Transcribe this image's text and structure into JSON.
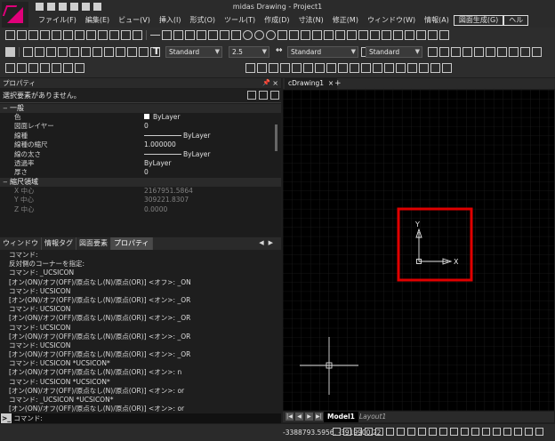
{
  "app": {
    "title": "midas Drawing - Project1"
  },
  "menu": [
    {
      "label": "ファイル(F)"
    },
    {
      "label": "編集(E)"
    },
    {
      "label": "ビュー(V)"
    },
    {
      "label": "挿入(I)"
    },
    {
      "label": "形式(O)"
    },
    {
      "label": "ツール(T)"
    },
    {
      "label": "作成(D)"
    },
    {
      "label": "寸法(N)"
    },
    {
      "label": "修正(M)"
    },
    {
      "label": "ウィンドウ(W)"
    },
    {
      "label": "情報(A)"
    },
    {
      "label": "図面生成(G)"
    },
    {
      "label": "ヘル"
    }
  ],
  "toolbar": {
    "text_style": "Standard",
    "text_height": "2.5",
    "dim_style": "Standard",
    "table_style": "Standard"
  },
  "properties": {
    "panel_title": "プロパティ",
    "selection_text": "選択要素がありません。",
    "section_general": "一般",
    "rows": [
      {
        "label": "色",
        "value": "ByLayer"
      },
      {
        "label": "図面レイヤー",
        "value": "0"
      },
      {
        "label": "線種",
        "value": "ByLayer"
      },
      {
        "label": "線種の縮尺",
        "value": "1.000000"
      },
      {
        "label": "線の太さ",
        "value": "ByLayer"
      },
      {
        "label": "透過率",
        "value": "ByLayer"
      },
      {
        "label": "厚さ",
        "value": "0"
      }
    ],
    "section_scale": "縮尺領域",
    "scale_rows": [
      {
        "label": "X 中心",
        "value": "2167951.5864"
      },
      {
        "label": "Y 中心",
        "value": "309221.8307"
      },
      {
        "label": "Z 中心",
        "value": "0.0000"
      }
    ]
  },
  "panel_tabs": [
    {
      "label": "ウィンドウ"
    },
    {
      "label": "情報タグ"
    },
    {
      "label": "図面要素"
    },
    {
      "label": "プロパティ"
    }
  ],
  "command_log": [
    "コマンド:",
    "反対側のコーナーを指定:",
    "コマンド: _UCSICON",
    "[オン(ON)/オフ(OFF)/原点なし(N)/原点(OR)] <オフ>: _ON",
    "コマンド: UCSICON",
    "[オン(ON)/オフ(OFF)/原点なし(N)/原点(OR)] <オン>: _OR",
    "コマンド: UCSICON",
    "[オン(ON)/オフ(OFF)/原点なし(N)/原点(OR)] <オン>: _OR",
    "コマンド: UCSICON",
    "[オン(ON)/オフ(OFF)/原点なし(N)/原点(OR)] <オン>: _OR",
    "コマンド: UCSICON",
    "[オン(ON)/オフ(OFF)/原点なし(N)/原点(OR)] <オン>: _OR",
    "コマンド: UCSICON *UCSICON*",
    "[オン(ON)/オフ(OFF)/原点なし(N)/原点(OR)] <オン>: n",
    "コマンド: UCSICON *UCSICON*",
    "[オン(ON)/オフ(OFF)/原点なし(N)/原点(OR)] <オン>: or",
    "コマンド: _UCSICON *UCSICON*",
    "[オン(ON)/オフ(OFF)/原点なし(N)/原点(OR)] <オン>: or"
  ],
  "command_prompt": "コマンド:",
  "drawing_tab": "cDrawing1",
  "ucs": {
    "x_label": "X",
    "y_label": "Y"
  },
  "layout_tabs": {
    "model": "Model1",
    "layout": "Layout1"
  },
  "status": {
    "coords": "-3388793.5956, -3919900.22"
  },
  "colors": {
    "highlight": "#e00000",
    "grid": "#2b2b2b",
    "brand": "#e0007a"
  }
}
